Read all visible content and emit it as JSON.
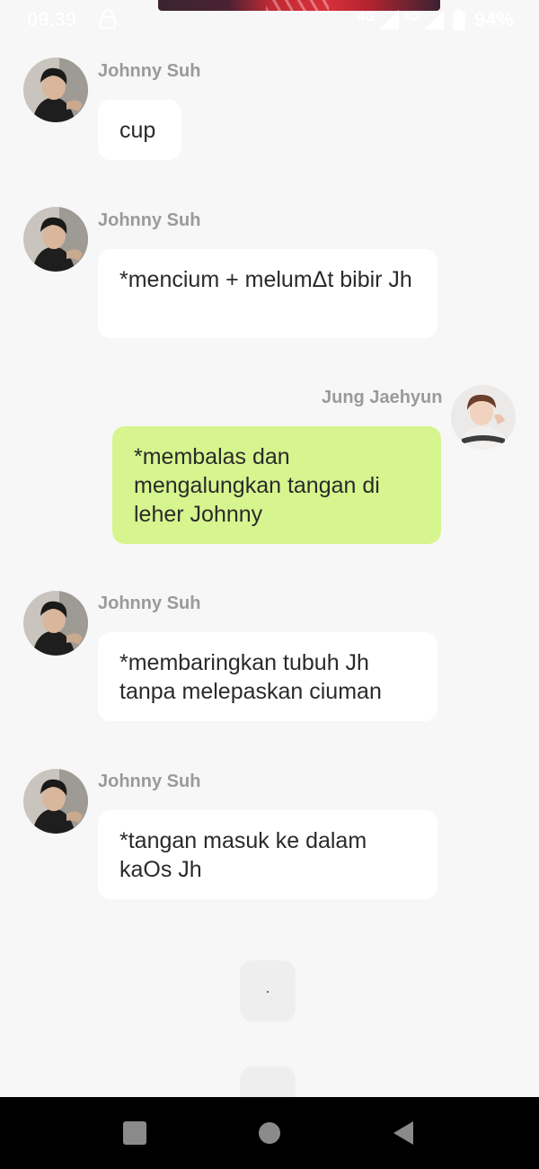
{
  "status_bar": {
    "time": "09.39",
    "network_1": "4G",
    "network_2": "4G",
    "battery": "94%"
  },
  "messages": [
    {
      "sender": "Johnny Suh",
      "text": "cup",
      "side": "left"
    },
    {
      "sender": "Johnny Suh",
      "text": "*mencium + melumΔt bibir Jh",
      "side": "left"
    },
    {
      "sender": "Jung Jaehyun",
      "text": "*membalas dan mengalungkan tangan di leher Johnny",
      "side": "right"
    },
    {
      "sender": "Johnny Suh",
      "text": "*membaringkan tubuh Jh tanpa melepaskan ciuman",
      "side": "left"
    },
    {
      "sender": "Johnny Suh",
      "text": "*tangan masuk ke dalam kaOs Jh",
      "side": "left"
    }
  ],
  "typing_indicator": {
    "text": "."
  },
  "nav_bar": {
    "icons": [
      "recent-apps-icon",
      "home-icon",
      "back-icon"
    ]
  },
  "colors": {
    "background": "#f7f7f7",
    "incoming_bubble": "#ffffff",
    "outgoing_bubble": "#d6f58f",
    "sender_name": "#9a9a9a",
    "nav_bar": "#000000"
  }
}
